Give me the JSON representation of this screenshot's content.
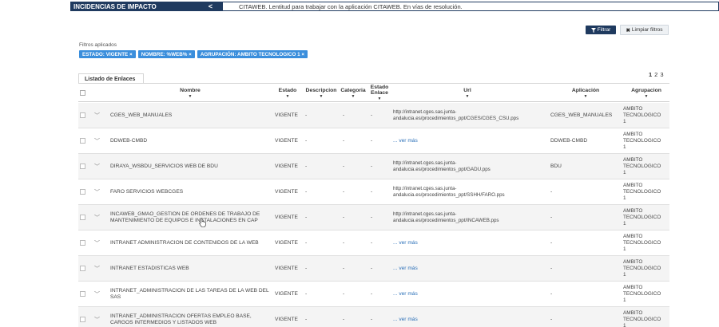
{
  "banner": {
    "title": "INCIDENCIAS DE IMPACTO",
    "chevron": "<",
    "message": "CITAWEB. Lentitud para trabajar con la aplicación CITAWEB. En vías de resolución."
  },
  "toolbar": {
    "filter_label": "Filtrar",
    "clear_label": "Limpiar filtros"
  },
  "filters": {
    "label": "Filtros aplicados",
    "chips": [
      "ESTADO: VIGENTE ×",
      "NOMBRE: %WEB% ×",
      "AGRUPACIÓN: AMBITO TECNOLOGICO 1 ×"
    ]
  },
  "tab": {
    "label": "Listado de Enlaces"
  },
  "pagination": {
    "current": "1",
    "pages": [
      "2",
      "3"
    ]
  },
  "columns": {
    "nombre": "Nombre",
    "estado": "Estado",
    "descripcion": "Descripcion",
    "categoria": "Categoria",
    "estado_enlace_1": "Estado",
    "estado_enlace_2": "Enlace",
    "url": "Url",
    "aplicacion": "Aplicación",
    "agrupacion": "Agrupacion"
  },
  "rows": [
    {
      "nombre": "CGES_WEB_MANUALES",
      "estado": "VIGENTE",
      "descripcion": "-",
      "categoria": "-",
      "estado_enlace": "-",
      "url_1": "http://intranet.cges.sas.junta-",
      "url_2": "andalucia.es/procedimientos_ppt/CGES/CGES_CSU.pps",
      "ver_mas": "",
      "aplicacion": "CGES_WEB_MANUALES",
      "agr_1": "AMBITO",
      "agr_2": "TECNOLOGICO",
      "agr_3": "1"
    },
    {
      "nombre": "DDWEB-CMBD",
      "estado": "VIGENTE",
      "descripcion": "-",
      "categoria": "-",
      "estado_enlace": "-",
      "url_1": "",
      "url_2": "",
      "ver_mas": "... ver más",
      "aplicacion": "DDWEB-CMBD",
      "agr_1": "AMBITO",
      "agr_2": "TECNOLOGICO",
      "agr_3": "1"
    },
    {
      "nombre": "DIRAYA_WSBDU_SERVICIOS WEB DE BDU",
      "estado": "VIGENTE",
      "descripcion": "-",
      "categoria": "-",
      "estado_enlace": "-",
      "url_1": "http://intranet.cges.sas.junta-",
      "url_2": "andalucia.es/procedimientos_ppt/GADU.pps",
      "ver_mas": "",
      "aplicacion": "BDU",
      "agr_1": "AMBITO",
      "agr_2": "TECNOLOGICO",
      "agr_3": "1"
    },
    {
      "nombre": "FARO SERVICIOS WEBCGES",
      "estado": "VIGENTE",
      "descripcion": "-",
      "categoria": "-",
      "estado_enlace": "-",
      "url_1": "http://intranet.cges.sas.junta-",
      "url_2": "andalucia.es/procedimientos_ppt/SSHH/FARO.pps",
      "ver_mas": "",
      "aplicacion": "-",
      "agr_1": "AMBITO",
      "agr_2": "TECNOLOGICO",
      "agr_3": "1"
    },
    {
      "nombre": "INCAWEB_GMAO_GESTION DE ORDENES DE TRABAJO DE MANTENIMIENTO DE EQUIPOS E INSTALACIONES EN CAP",
      "estado": "VIGENTE",
      "descripcion": "-",
      "categoria": "-",
      "estado_enlace": "-",
      "url_1": "http://intranet.cges.sas.junta-",
      "url_2": "andalucia.es/procedimientos_ppt/INCAWEB.pps",
      "ver_mas": "",
      "aplicacion": "-",
      "agr_1": "AMBITO",
      "agr_2": "TECNOLOGICO",
      "agr_3": "1"
    },
    {
      "nombre": "INTRANET ADMINISTRACION DE CONTENIDOS DE LA WEB",
      "estado": "VIGENTE",
      "descripcion": "-",
      "categoria": "-",
      "estado_enlace": "-",
      "url_1": "",
      "url_2": "",
      "ver_mas": "... ver más",
      "aplicacion": "-",
      "agr_1": "AMBITO",
      "agr_2": "TECNOLOGICO",
      "agr_3": "1"
    },
    {
      "nombre": "INTRANET ESTADISTICAS WEB",
      "estado": "VIGENTE",
      "descripcion": "-",
      "categoria": "-",
      "estado_enlace": "-",
      "url_1": "",
      "url_2": "",
      "ver_mas": "... ver más",
      "aplicacion": "-",
      "agr_1": "AMBITO",
      "agr_2": "TECNOLOGICO",
      "agr_3": "1"
    },
    {
      "nombre": "INTRANET_ADMINISTRACION DE LAS TAREAS DE LA WEB DEL SAS",
      "estado": "VIGENTE",
      "descripcion": "-",
      "categoria": "-",
      "estado_enlace": "-",
      "url_1": "",
      "url_2": "",
      "ver_mas": "... ver más",
      "aplicacion": "-",
      "agr_1": "AMBITO",
      "agr_2": "TECNOLOGICO",
      "agr_3": "1"
    },
    {
      "nombre": "INTRANET_ADMINISTRACION OFERTAS EMPLEO BASE, CARGOS INTERMEDIOS Y LISTADOS WEB",
      "estado": "VIGENTE",
      "descripcion": "-",
      "categoria": "-",
      "estado_enlace": "-",
      "url_1": "",
      "url_2": "",
      "ver_mas": "... ver más",
      "aplicacion": "-",
      "agr_1": "AMBITO",
      "agr_2": "TECNOLOGICO",
      "agr_3": "1"
    }
  ],
  "icons": {
    "filter": "funnel-icon",
    "clear": "close-icon",
    "expand": "chevron-down-icon",
    "sort": "sort-down-icon"
  },
  "colors": {
    "banner": "#1f3a5f",
    "chip": "#3a8edc",
    "link": "#2a6fb8"
  }
}
